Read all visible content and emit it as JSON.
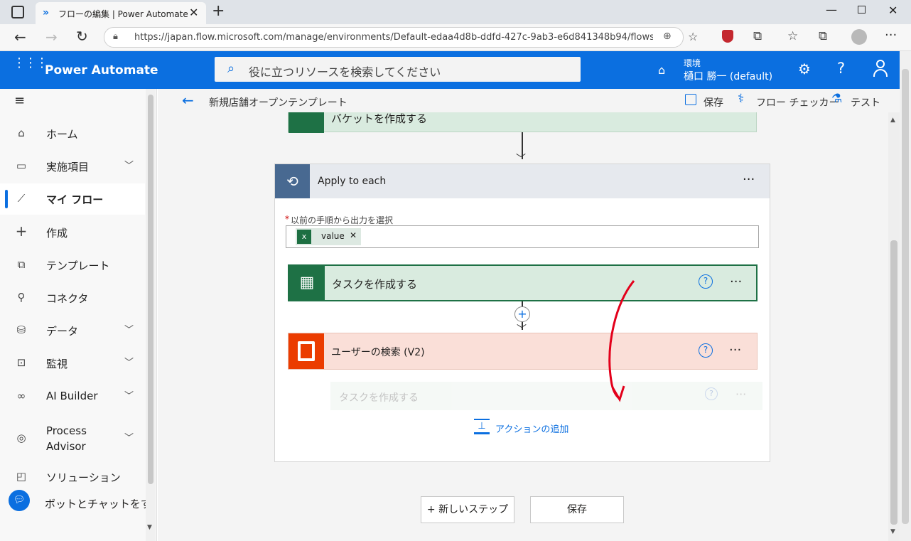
{
  "browser": {
    "tab_title": "フローの編集 | Power Automate",
    "url": "https://japan.flow.microsoft.com/manage/environments/Default-edaa4d8b-ddfd-427c-9ab3-e6d841348b94/flows/ff..."
  },
  "app": {
    "name": "Power Automate",
    "search_placeholder": "役に立つリソースを検索してください",
    "env_label": "環境",
    "env_name": "樋口 勝一 (default)"
  },
  "sidebar": {
    "items": [
      {
        "label": "ホーム",
        "icon": "home-icon"
      },
      {
        "label": "実施項目",
        "icon": "clipboard-icon"
      },
      {
        "label": "マイ フロー",
        "icon": "flow-icon"
      },
      {
        "label": "作成",
        "icon": "plus-icon"
      },
      {
        "label": "テンプレート",
        "icon": "template-icon"
      },
      {
        "label": "コネクタ",
        "icon": "connector-icon"
      },
      {
        "label": "データ",
        "icon": "database-icon"
      },
      {
        "label": "監視",
        "icon": "monitor-icon"
      },
      {
        "label": "AI Builder",
        "icon": "ai-builder-icon"
      },
      {
        "label": "Process Advisor",
        "icon": "process-advisor-icon"
      },
      {
        "label": "ソリューション",
        "icon": "solution-icon"
      }
    ],
    "chat_label": "ボットとチャットをする"
  },
  "editor": {
    "flow_name": "新規店舗オープンテンプレート",
    "save": "保存",
    "checker": "フロー チェッカー",
    "test": "テスト"
  },
  "flow": {
    "top_card_label": "バケットを作成する",
    "loop_title": "Apply to each",
    "select_label": "以前の手順から出力を選択",
    "token": "value",
    "action1": "タスクを作成する",
    "action2": "ユーザーの検索 (V2)",
    "ghost": "タスクを作成する",
    "add_action": "アクションの追加",
    "new_step": "+ 新しいステップ",
    "save_button": "保存"
  },
  "colors": {
    "appbar": "#0b6fe0",
    "planner": "#1e7145",
    "planner_bg": "#d9ebdf",
    "office": "#eb3c00",
    "office_bg": "#fadfd8",
    "loop": "#486991",
    "accent": "#0f6cbd"
  }
}
